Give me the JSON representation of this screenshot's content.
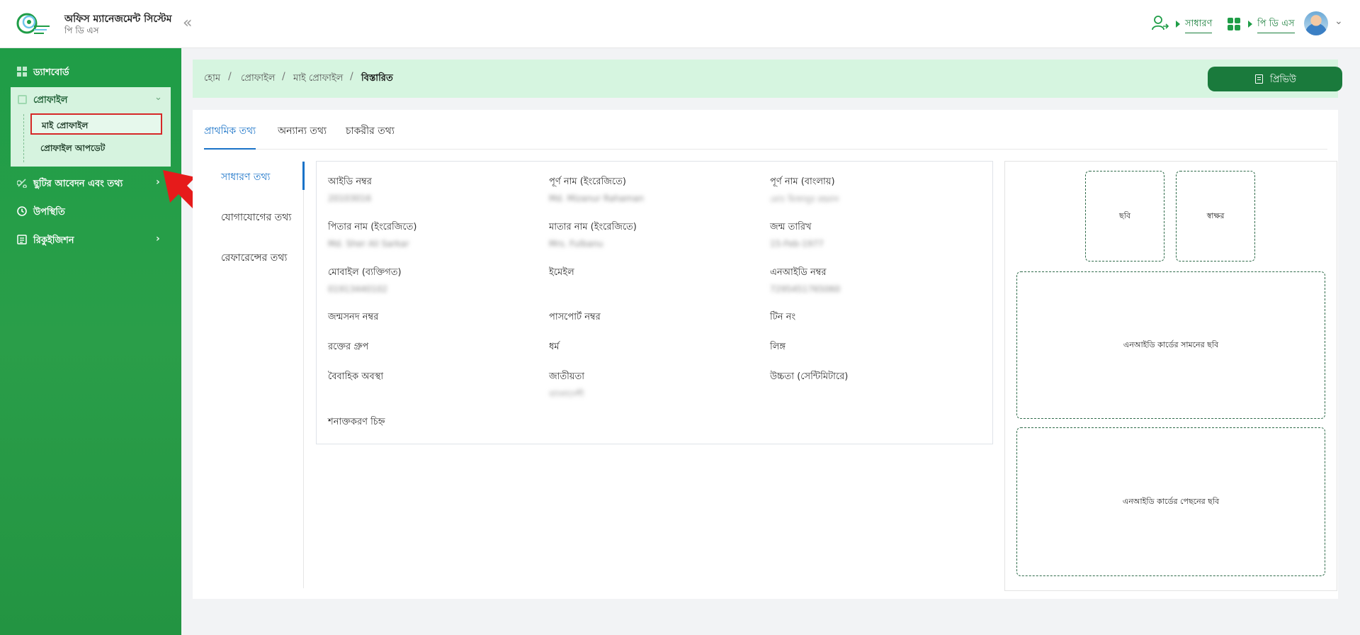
{
  "header": {
    "app_title": "অফিস ম্যানেজমেন্ট সিস্টেম",
    "app_subtitle": "পি ডি এস",
    "collapse_icon": "double-chevron-left-icon",
    "role_label": "সাধারণ",
    "module_label": "পি ডি এস",
    "brand_color": "#1f9d47"
  },
  "sidebar": {
    "items": [
      {
        "label": "ড্যাশবোর্ড",
        "icon": "dashboard-grid-icon"
      },
      {
        "label": "প্রোফাইল",
        "icon": "profile-icon",
        "expanded": true,
        "children": [
          {
            "label": "মাই প্রোফাইল",
            "active": true
          },
          {
            "label": "প্রোফাইল আপডেট"
          }
        ]
      },
      {
        "label": "ছুটির আবেদন এবং তথ্য",
        "icon": "leave-icon"
      },
      {
        "label": "উপস্থিতি",
        "icon": "clock-icon"
      },
      {
        "label": "রিকুইজিশন",
        "icon": "requisition-icon"
      }
    ],
    "highlight_color": "#d62828"
  },
  "breadcrumb": {
    "items": [
      "হোম",
      "প্রোফাইল",
      "মাই প্রোফাইল",
      "বিস্তারিত"
    ],
    "separator": "/",
    "preview_label": "প্রিভিউ"
  },
  "tabs": [
    "প্রাথমিক তথ্য",
    "অন্যান্য তথ্য",
    "চাকরীর তথ্য"
  ],
  "side_tabs": [
    "সাধারণ তথ্য",
    "যোগাযোগের তথ্য",
    "রেফারেন্সের তথ্য"
  ],
  "fields": [
    {
      "label": "আইডি নম্বর",
      "value": "20103016"
    },
    {
      "label": "পূর্ণ নাম (ইংরেজিতে)",
      "value": "Md. Mizanur Rahaman"
    },
    {
      "label": "পূর্ণ নাম (বাংলায়)",
      "value": "মোঃ মিজানুর রহমান"
    },
    {
      "label": "পিতার নাম (ইংরেজিতে)",
      "value": "Md. Sher Ali Sarkar"
    },
    {
      "label": "মাতার নাম (ইংরেজিতে)",
      "value": "Mrs. Fulbanu"
    },
    {
      "label": "জন্ম তারিখ",
      "value": "15-Feb-1977"
    },
    {
      "label": "মোবাইল (ব্যক্তিগত)",
      "value": "01913440102"
    },
    {
      "label": "ইমেইল",
      "value": ""
    },
    {
      "label": "এনআইডি নম্বর",
      "value": "7295451765060"
    },
    {
      "label": "জন্মসনদ নম্বর",
      "value": ""
    },
    {
      "label": "পাসপোর্ট নম্বর",
      "value": ""
    },
    {
      "label": "টিন নং",
      "value": ""
    },
    {
      "label": "রক্তের গ্রুপ",
      "value": ""
    },
    {
      "label": "ধর্ম",
      "value": ""
    },
    {
      "label": "লিঙ্গ",
      "value": ""
    },
    {
      "label": "বৈবাহিক অবস্থা",
      "value": ""
    },
    {
      "label": "জাতীয়তা",
      "value": "বাংলাদেশী"
    },
    {
      "label": "উচ্চতা (সেন্টিমিটারে)",
      "value": ""
    },
    {
      "label": "শনাক্তকরণ চিহ্ন",
      "value": ""
    }
  ],
  "photos": {
    "photo_label": "ছবি",
    "signature_label": "স্বাক্ষর",
    "nid_front_label": "এনআইডি কার্ডের সামনের ছবি",
    "nid_back_label": "এনআইডি কার্ডের পেছনের ছবি"
  }
}
